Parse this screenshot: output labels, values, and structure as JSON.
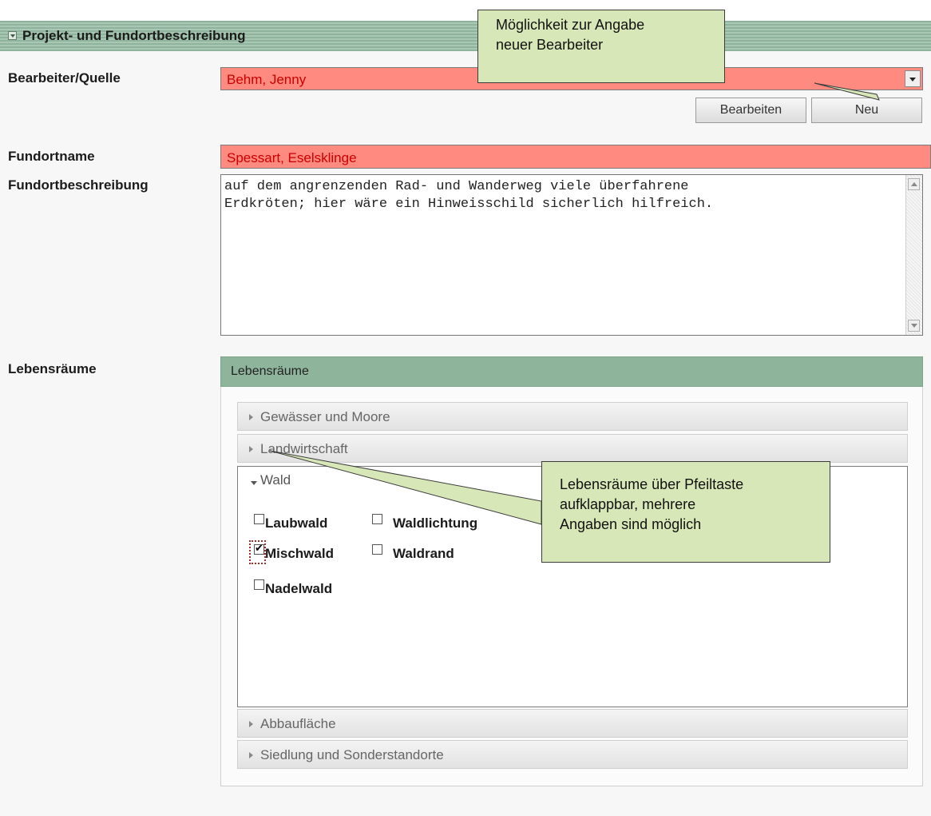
{
  "section": {
    "title": "Projekt- und Fundortbeschreibung"
  },
  "form": {
    "bearbeiter": {
      "label": "Bearbeiter/Quelle",
      "value": "Behm, Jenny",
      "edit_button": "Bearbeiten",
      "new_button": "Neu"
    },
    "fundortname": {
      "label": "Fundortname",
      "value": "Spessart, Eselsklinge"
    },
    "fundortbeschreibung": {
      "label": "Fundortbeschreibung",
      "line1": "auf dem angrenzenden Rad- und Wanderweg viele überfahrene",
      "line2": "Erdkröten; hier wäre ein Hinweisschild sicherlich hilfreich."
    },
    "lebensraeume": {
      "label": "Lebensräume",
      "panel_title": "Lebensräume",
      "groups": [
        {
          "label": "Gewässer und Moore",
          "expanded": false
        },
        {
          "label": "Landwirtschaft",
          "expanded": false
        },
        {
          "label": "Wald",
          "expanded": true
        },
        {
          "label": "Abbaufläche",
          "expanded": false
        },
        {
          "label": "Siedlung und Sonderstandorte",
          "expanded": false
        }
      ],
      "wald_options": [
        {
          "label": "Laubwald",
          "checked": false
        },
        {
          "label": "Waldlichtung",
          "checked": false
        },
        {
          "label": "Mischwald",
          "checked": true
        },
        {
          "label": "Waldrand",
          "checked": false
        },
        {
          "label": "Nadelwald",
          "checked": false
        }
      ]
    }
  },
  "callouts": {
    "top": {
      "line1": "Möglichkeit zur Angabe",
      "line2": "neuer Bearbeiter"
    },
    "bottom": {
      "line1": "Lebensräume über Pfeiltaste",
      "line2": "aufklappbar, mehrere",
      "line3": "Angaben sind möglich"
    }
  },
  "colors": {
    "header_green": "#8fb39c",
    "required_field": "#ff8a80",
    "callout_fill": "#d8e7b8"
  }
}
